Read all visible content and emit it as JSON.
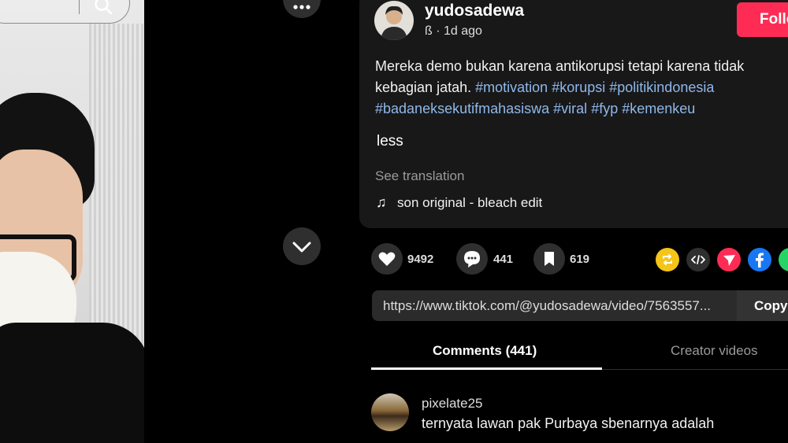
{
  "search": {
    "icon": "search-icon"
  },
  "nav": {
    "more_icon": "more-horizontal-icon",
    "down_icon": "chevron-down-icon"
  },
  "author": {
    "username": "yudosadewa",
    "meta": "ß · 1d ago",
    "follow_label": "Follo"
  },
  "description": {
    "text": "Mereka demo bukan karena antikorupsi tetapi karena tidak kebagian jatah.",
    "hashtags": [
      "#motivation",
      "#korupsi",
      "#politikindonesia",
      "#badaneksekutifmahasiswa",
      "#viral",
      "#fyp",
      "#kemenkeu"
    ],
    "less_label": "less",
    "see_translation": "See translation",
    "music": "son original - bleach edit"
  },
  "actions": {
    "likes": "9492",
    "comments": "441",
    "saves": "619"
  },
  "share": {
    "link": "https://www.tiktok.com/@yudosadewa/video/7563557...",
    "copy_label": "Copy"
  },
  "tabs": {
    "comments": "Comments (441)",
    "creator_videos": "Creator videos"
  },
  "comment": {
    "username": "pixelate25",
    "text": "ternyata lawan pak Purbaya sbenarnya adalah"
  },
  "colors": {
    "accent": "#fe2c55",
    "hashtag": "#8fb8ec",
    "panel": "#181818"
  }
}
